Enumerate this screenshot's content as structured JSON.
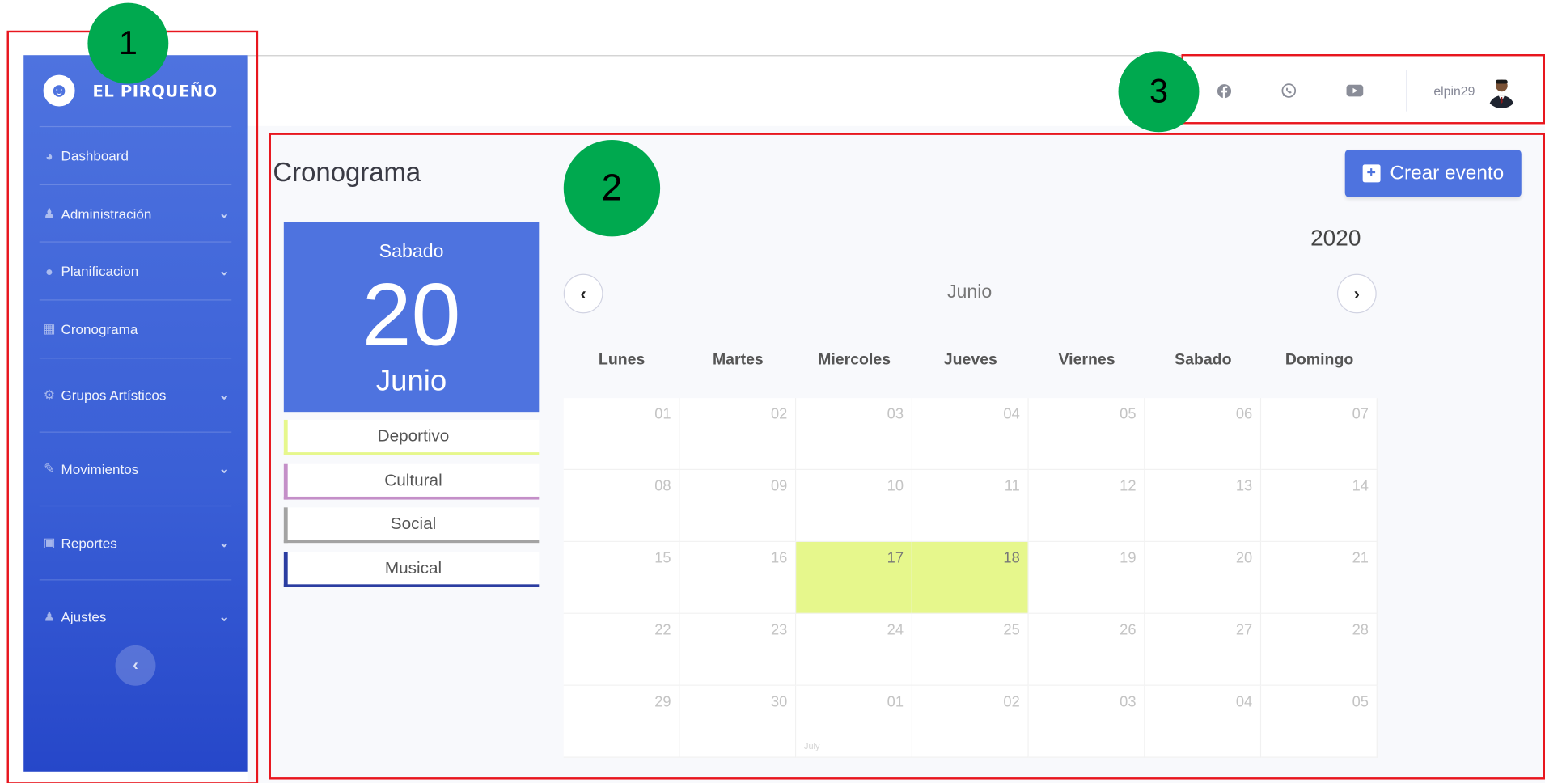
{
  "brand": {
    "name": "EL PIRQUEÑO"
  },
  "sidebar": {
    "items": [
      {
        "label": "Dashboard",
        "icon": "dashboard-icon",
        "has_submenu": false
      },
      {
        "label": "Administración",
        "icon": "user-cog-icon",
        "has_submenu": true
      },
      {
        "label": "Planificacion",
        "icon": "globe-icon",
        "has_submenu": true
      },
      {
        "label": "Cronograma",
        "icon": "calendar-icon",
        "has_submenu": false
      },
      {
        "label": "Grupos Artísticos",
        "icon": "gear-icon",
        "has_submenu": true
      },
      {
        "label": "Movimientos",
        "icon": "pencil-icon",
        "has_submenu": true
      },
      {
        "label": "Reportes",
        "icon": "book-icon",
        "has_submenu": true
      },
      {
        "label": "Ajustes",
        "icon": "user-cog-icon",
        "has_submenu": true
      }
    ]
  },
  "topbar": {
    "social": [
      "facebook-icon",
      "whatsapp-icon",
      "youtube-icon"
    ],
    "username": "elpin29"
  },
  "page": {
    "title": "Cronograma",
    "create_button": "Crear evento"
  },
  "selected_date": {
    "weekday": "Sabado",
    "day": "20",
    "month": "Junio"
  },
  "categories": [
    {
      "label": "Deportivo",
      "color": "#e6f78c"
    },
    {
      "label": "Cultural",
      "color": "#c48fc8"
    },
    {
      "label": "Social",
      "color": "#a3a3a3"
    },
    {
      "label": "Musical",
      "color": "#2b3da1"
    }
  ],
  "calendar": {
    "year": "2020",
    "month": "Junio",
    "weekdays": [
      "Lunes",
      "Martes",
      "Miercoles",
      "Jueves",
      "Viernes",
      "Sabado",
      "Domingo"
    ],
    "weeks": [
      [
        "01",
        "02",
        "03",
        "04",
        "05",
        "06",
        "07"
      ],
      [
        "08",
        "09",
        "10",
        "11",
        "12",
        "13",
        "14"
      ],
      [
        "15",
        "16",
        "17",
        "18",
        "19",
        "20",
        "21"
      ],
      [
        "22",
        "23",
        "24",
        "25",
        "26",
        "27",
        "28"
      ],
      [
        "29",
        "30",
        "01",
        "02",
        "03",
        "04",
        "05"
      ]
    ],
    "highlighted": [
      "17",
      "18"
    ],
    "highlight_color": "#e6f78c",
    "next_month_label": "July"
  },
  "annotations": [
    "1",
    "2",
    "3"
  ],
  "colors": {
    "primary": "#4e73df",
    "annotation_red": "#e8161e",
    "annotation_green": "#00a94f"
  }
}
